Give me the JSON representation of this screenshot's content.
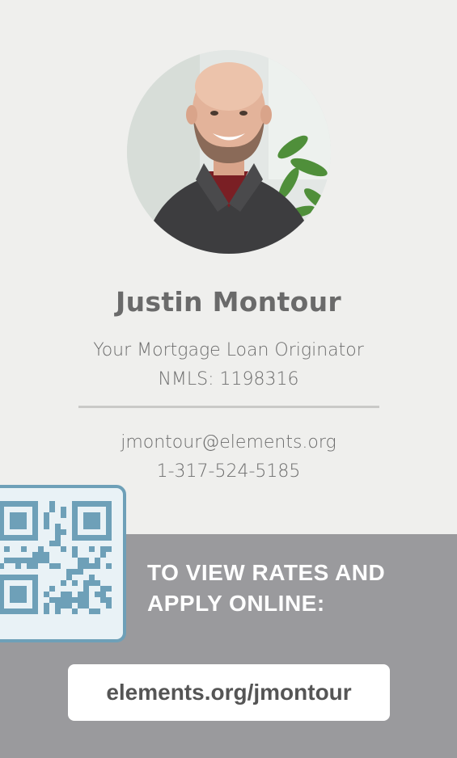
{
  "profile": {
    "name": "Justin Montour",
    "role": "Your Mortgage Loan Originator",
    "nmls": "NMLS: 1198316",
    "email": "jmontour@elements.org",
    "phone": "1-317-524-5185"
  },
  "cta": {
    "line1": "TO VIEW RATES AND",
    "line2": "APPLY ONLINE:",
    "url": "elements.org/jmontour"
  },
  "colors": {
    "background": "#efefed",
    "band": "#9a9a9d",
    "text": "#6a6a6a",
    "qr": "#6ea0b8"
  },
  "icons": {
    "qr": "qr-code-icon"
  }
}
